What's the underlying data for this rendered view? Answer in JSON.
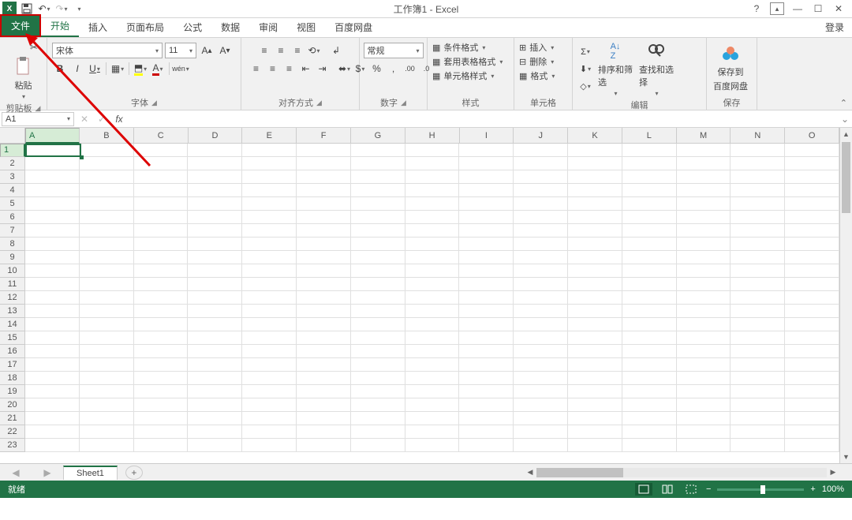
{
  "title": "工作簿1 - Excel",
  "login": "登录",
  "tabs": {
    "file": "文件",
    "items": [
      "开始",
      "插入",
      "页面布局",
      "公式",
      "数据",
      "审阅",
      "视图",
      "百度网盘"
    ],
    "active": 0
  },
  "ribbon": {
    "clipboard": {
      "label": "剪贴板",
      "paste": "粘贴"
    },
    "font": {
      "label": "字体",
      "name": "宋体",
      "size": "11",
      "bold": "B",
      "italic": "I",
      "underline": "U"
    },
    "align": {
      "label": "对齐方式"
    },
    "number": {
      "label": "数字",
      "format": "常规"
    },
    "styles": {
      "label": "样式",
      "cond": "条件格式",
      "table": "套用表格格式",
      "cell": "单元格样式"
    },
    "cells": {
      "label": "单元格",
      "insert": "插入",
      "delete": "删除",
      "format": "格式"
    },
    "editing": {
      "label": "编辑",
      "sort": "排序和筛选",
      "find": "查找和选择"
    },
    "save": {
      "label": "保存",
      "saveto": "保存到",
      "netdisk": "百度网盘"
    }
  },
  "namebox": "A1",
  "columns": [
    "A",
    "B",
    "C",
    "D",
    "E",
    "F",
    "G",
    "H",
    "I",
    "J",
    "K",
    "L",
    "M",
    "N",
    "O"
  ],
  "rows": [
    "1",
    "2",
    "3",
    "4",
    "5",
    "6",
    "7",
    "8",
    "9",
    "10",
    "11",
    "12",
    "13",
    "14",
    "15",
    "16",
    "17",
    "18",
    "19",
    "20",
    "21",
    "22",
    "23"
  ],
  "sheet": {
    "name": "Sheet1"
  },
  "status": {
    "ready": "就绪",
    "zoom": "100%"
  }
}
